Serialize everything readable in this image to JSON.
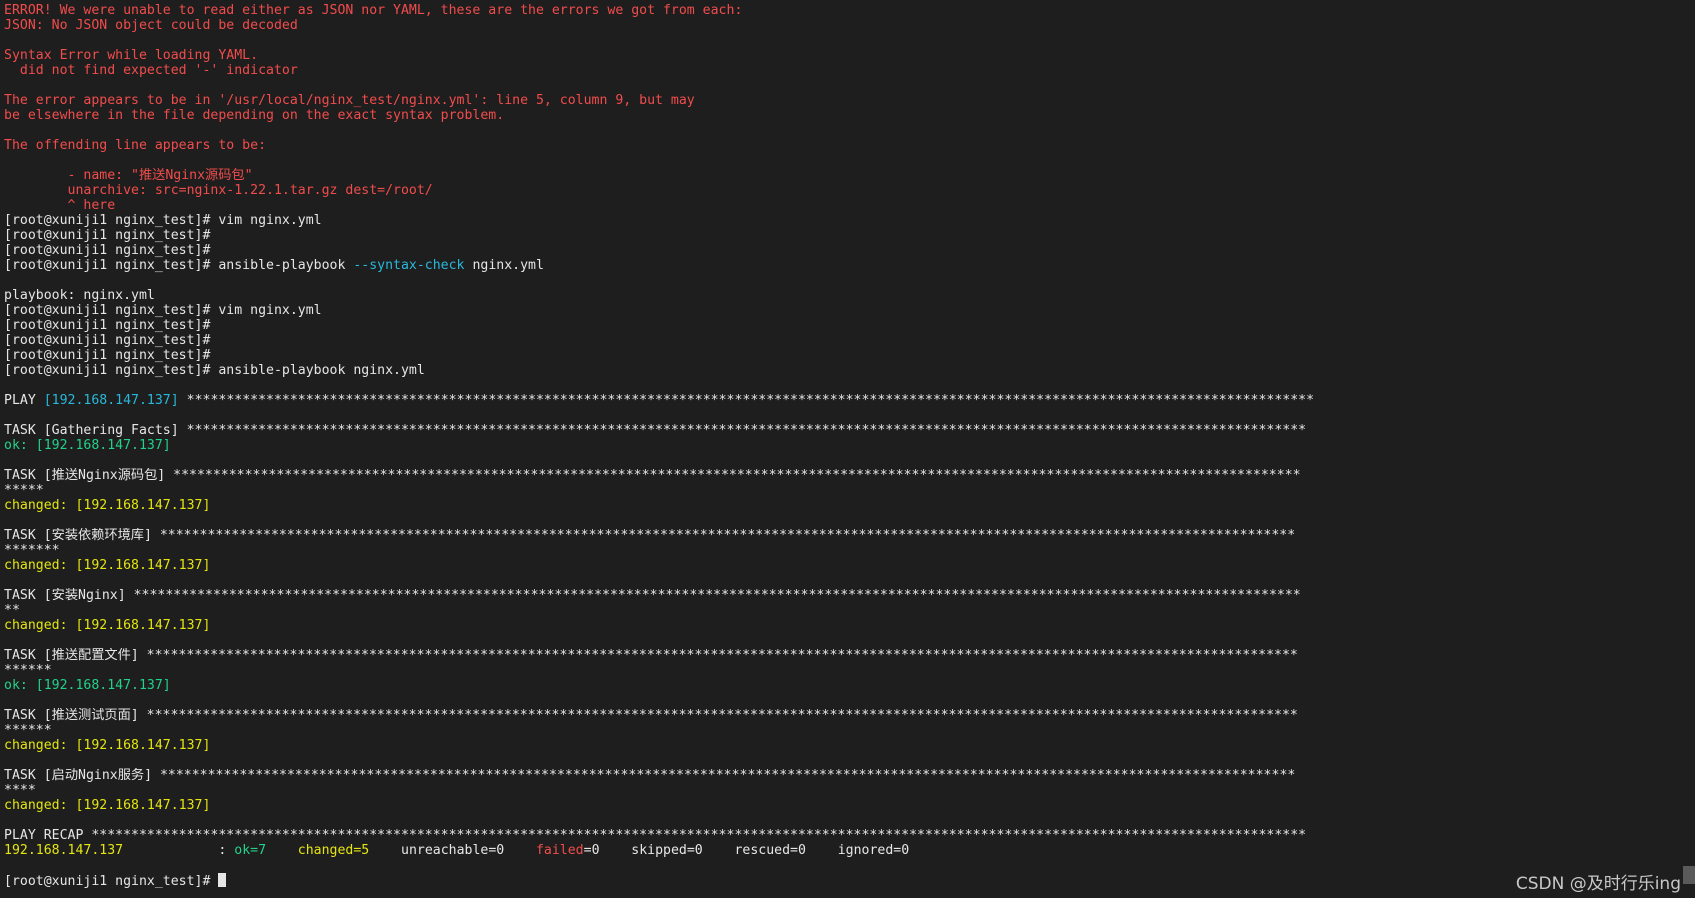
{
  "terminal": {
    "colors": {
      "background": "#1e1e1e",
      "text": "#e6e6e6",
      "error": "#f14c4c",
      "ok": "#23d18b",
      "changed": "#e5e510",
      "ip": "#29b8db"
    },
    "lines": [
      [
        {
          "t": "ERROR! We were unable to read either as JSON nor YAML, these are the errors we got from each:",
          "c": "error"
        }
      ],
      [
        {
          "t": "JSON: No JSON object could be decoded",
          "c": "error"
        }
      ],
      [],
      [
        {
          "t": "Syntax Error while loading YAML.",
          "c": "error"
        }
      ],
      [
        {
          "t": "  did not find expected '-' indicator",
          "c": "error"
        }
      ],
      [],
      [
        {
          "t": "The error appears to be in '/usr/local/nginx_test/nginx.yml': line 5, column 9, but may",
          "c": "error"
        }
      ],
      [
        {
          "t": "be elsewhere in the file depending on the exact syntax problem.",
          "c": "error"
        }
      ],
      [],
      [
        {
          "t": "The offending line appears to be:",
          "c": "error"
        }
      ],
      [],
      [
        {
          "t": "        - name: \"推送Nginx源码包\"",
          "c": "error"
        }
      ],
      [
        {
          "t": "        unarchive: src=nginx-1.22.1.tar.gz dest=/root/",
          "c": "error"
        }
      ],
      [
        {
          "t": "        ^ here",
          "c": "error"
        }
      ],
      [
        {
          "t": "[root@xuniji1 nginx_test]# vim nginx.yml",
          "c": "white"
        }
      ],
      [
        {
          "t": "[root@xuniji1 nginx_test]#",
          "c": "white"
        }
      ],
      [
        {
          "t": "[root@xuniji1 nginx_test]#",
          "c": "white"
        }
      ],
      [
        {
          "t": "[root@xuniji1 nginx_test]# ansible-playbook ",
          "c": "white"
        },
        {
          "t": "--syntax-check",
          "c": "flag"
        },
        {
          "t": " nginx.yml",
          "c": "white"
        }
      ],
      [],
      [
        {
          "t": "playbook: nginx.yml",
          "c": "white"
        }
      ],
      [
        {
          "t": "[root@xuniji1 nginx_test]# vim nginx.yml",
          "c": "white"
        }
      ],
      [
        {
          "t": "[root@xuniji1 nginx_test]#",
          "c": "white"
        }
      ],
      [
        {
          "t": "[root@xuniji1 nginx_test]#",
          "c": "white"
        }
      ],
      [
        {
          "t": "[root@xuniji1 nginx_test]#",
          "c": "white"
        }
      ],
      [
        {
          "t": "[root@xuniji1 nginx_test]# ansible-playbook nginx.yml",
          "c": "white"
        }
      ],
      [],
      [
        {
          "t": "PLAY ",
          "c": "white"
        },
        {
          "t": "[192.168.147.137]",
          "c": "ip"
        },
        {
          "t": " **********************************************************************************************************************************************",
          "c": "white"
        }
      ],
      [],
      [
        {
          "t": "TASK [Gathering Facts] *********************************************************************************************************************************************",
          "c": "white"
        }
      ],
      [
        {
          "t": "ok: [192.168.147.137]",
          "c": "ok"
        }
      ],
      [],
      [
        {
          "t": "TASK [推送Nginx源码包] **********************************************************************************************************************************************",
          "c": "white"
        }
      ],
      [
        {
          "t": "*****",
          "c": "white"
        }
      ],
      [
        {
          "t": "changed: [192.168.147.137]",
          "c": "changed"
        }
      ],
      [],
      [
        {
          "t": "TASK [安装依赖环境库] ***********************************************************************************************************************************************",
          "c": "white"
        }
      ],
      [
        {
          "t": "*******",
          "c": "white"
        }
      ],
      [
        {
          "t": "changed: [192.168.147.137]",
          "c": "changed"
        }
      ],
      [],
      [
        {
          "t": "TASK [安装Nginx] ***************************************************************************************************************************************************",
          "c": "white"
        }
      ],
      [
        {
          "t": "**",
          "c": "white"
        }
      ],
      [
        {
          "t": "changed: [192.168.147.137]",
          "c": "changed"
        }
      ],
      [],
      [
        {
          "t": "TASK [推送配置文件] *************************************************************************************************************************************************",
          "c": "white"
        }
      ],
      [
        {
          "t": "******",
          "c": "white"
        }
      ],
      [
        {
          "t": "ok: [192.168.147.137]",
          "c": "ok"
        }
      ],
      [],
      [
        {
          "t": "TASK [推送测试页面] *************************************************************************************************************************************************",
          "c": "white"
        }
      ],
      [
        {
          "t": "******",
          "c": "white"
        }
      ],
      [
        {
          "t": "changed: [192.168.147.137]",
          "c": "changed"
        }
      ],
      [],
      [
        {
          "t": "TASK [启动Nginx服务] ***********************************************************************************************************************************************",
          "c": "white"
        }
      ],
      [
        {
          "t": "****",
          "c": "white"
        }
      ],
      [
        {
          "t": "changed: [192.168.147.137]",
          "c": "changed"
        }
      ],
      [],
      [
        {
          "t": "PLAY RECAP *********************************************************************************************************************************************************",
          "c": "white"
        }
      ],
      [
        {
          "t": "192.168.147.137",
          "c": "changed"
        },
        {
          "t": "            : ",
          "c": "white"
        },
        {
          "t": "ok=7",
          "c": "ok"
        },
        {
          "t": "    ",
          "c": "white"
        },
        {
          "t": "changed=5",
          "c": "changed"
        },
        {
          "t": "    unreachable=0    ",
          "c": "white"
        },
        {
          "t": "failed",
          "c": "error"
        },
        {
          "t": "=0    skipped=0    rescued=0    ignored=0",
          "c": "white"
        }
      ],
      [],
      [
        {
          "t": "[root@xuniji1 nginx_test]# ",
          "c": "white"
        }
      ]
    ]
  },
  "watermark": "CSDN @及时行乐ing"
}
